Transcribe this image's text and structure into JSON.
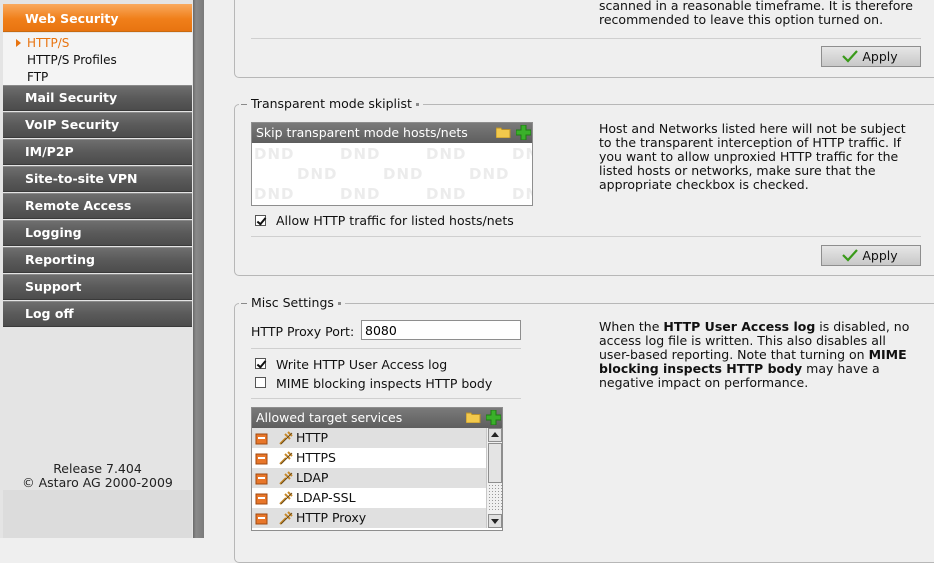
{
  "sidebar": {
    "active": "Web Security",
    "subitems": [
      "HTTP/S",
      "HTTP/S Profiles",
      "FTP"
    ],
    "items": [
      "Mail Security",
      "VoIP Security",
      "IM/P2P",
      "Site-to-site VPN",
      "Remote Access",
      "Logging",
      "Reporting",
      "Support",
      "Log off"
    ],
    "release": "Release 7.404",
    "copyright": "© Astaro AG 2000-2009"
  },
  "top_section": {
    "help_line1": "scanned in a reasonable timeframe. It is therefore",
    "help_line2": "recommended to leave this option turned on.",
    "apply_label": "Apply"
  },
  "skiplist": {
    "legend": "Transparent mode skiplist",
    "list_header": "Skip transparent mode hosts/nets",
    "dnd_text": "DND",
    "checkbox_label": "Allow HTTP traffic for listed hosts/nets",
    "checkbox_checked": true,
    "help": [
      "Host and Networks listed here will not be subject",
      "to the transparent interception of HTTP traffic. If",
      "you want to allow unproxied HTTP traffic for the",
      "listed hosts or networks, make sure that the",
      "appropriate checkbox is checked."
    ],
    "apply_label": "Apply"
  },
  "misc": {
    "legend": "Misc Settings",
    "proxy_port_label": "HTTP Proxy Port:",
    "proxy_port_value": "8080",
    "write_log_label": "Write HTTP User Access log",
    "write_log_checked": true,
    "mime_label": "MIME blocking inspects HTTP body",
    "mime_checked": false,
    "help": {
      "p1": "When the ",
      "b1": "HTTP User Access log",
      "p2": " is disabled, no",
      "l2": "access log file is written. This also disables all",
      "l3a": "user-based reporting. Note that turning on ",
      "b2": "MIME",
      "b3": "blocking inspects HTTP body",
      "l4b": " may have a",
      "l5": "negative impact on performance."
    },
    "services_header": "Allowed target services",
    "services": [
      "HTTP",
      "HTTPS",
      "LDAP",
      "LDAP-SSL",
      "HTTP Proxy"
    ]
  },
  "colors": {
    "accent_orange": "#f07f1a",
    "nav_gray": "#5a5a5a",
    "apply_check_green": "#3a9a1a"
  }
}
